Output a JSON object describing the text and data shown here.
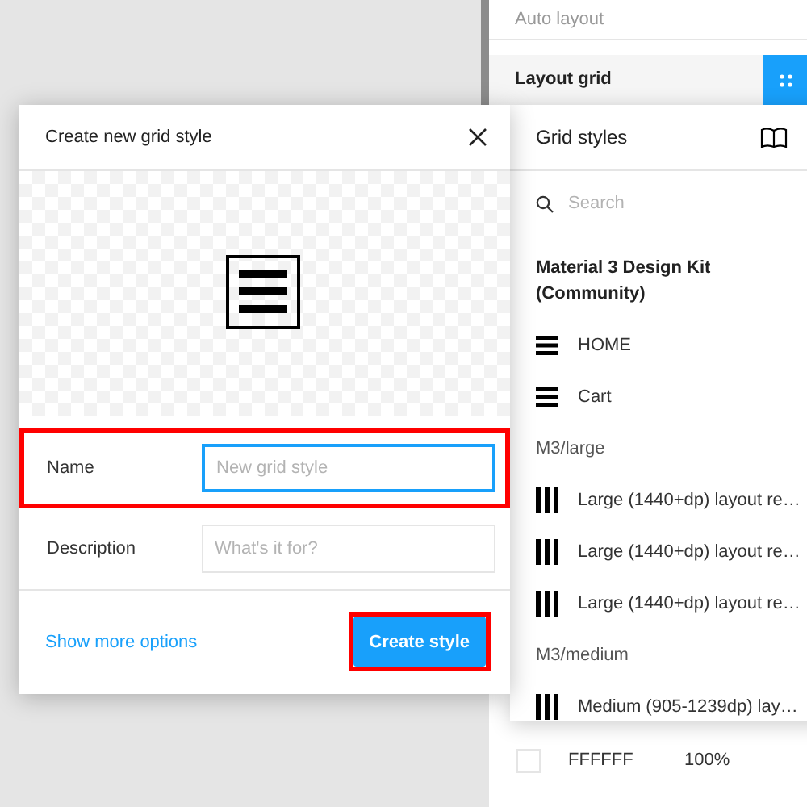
{
  "panel": {
    "auto_layout": "Auto layout",
    "layout_grid": "Layout grid",
    "fill": {
      "hex": "FFFFFF",
      "opacity": "100%"
    }
  },
  "grid_styles": {
    "title": "Grid styles",
    "search": {
      "placeholder": "Search"
    },
    "items": [
      {
        "kind": "library",
        "label": "Material 3 Design Kit (Community)"
      },
      {
        "kind": "rows",
        "label": "HOME"
      },
      {
        "kind": "rows",
        "label": "Cart"
      },
      {
        "kind": "group",
        "label": "M3/large"
      },
      {
        "kind": "columns",
        "label": "Large (1440+dp) layout re…"
      },
      {
        "kind": "columns",
        "label": "Large (1440+dp) layout re…"
      },
      {
        "kind": "columns",
        "label": "Large (1440+dp) layout re…"
      },
      {
        "kind": "group",
        "label": "M3/medium"
      },
      {
        "kind": "columns",
        "label": "Medium (905-1239dp) lay…"
      }
    ]
  },
  "dialog": {
    "title": "Create new grid style",
    "fields": [
      {
        "label": "Name",
        "placeholder": "New grid style",
        "focused": true,
        "highlighted": true
      },
      {
        "label": "Description",
        "placeholder": "What's it for?",
        "focused": false,
        "highlighted": false
      }
    ],
    "link": "Show more options",
    "button": {
      "label": "Create style",
      "highlighted": true
    }
  }
}
